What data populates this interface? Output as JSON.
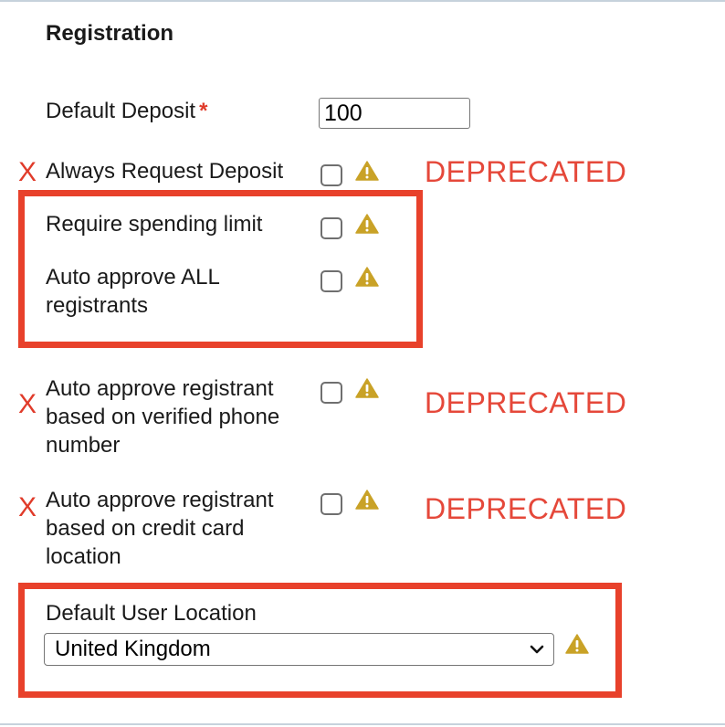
{
  "section": {
    "title": "Registration"
  },
  "fields": {
    "default_deposit": {
      "label": "Default Deposit",
      "required_mark": "*",
      "value": "100"
    },
    "always_request_deposit": {
      "label": "Always Request Deposit",
      "deprecated_mark": "X",
      "deprecated_note": "DEPRECATED",
      "checked": false
    },
    "require_spending_limit": {
      "label": "Require spending limit",
      "checked": false
    },
    "auto_approve_all": {
      "line1": "Auto approve ALL",
      "line2": "registrants",
      "checked": false
    },
    "auto_approve_phone": {
      "line1": "Auto approve registrant",
      "line2": "based on verified phone",
      "line3": "number",
      "deprecated_mark": "X",
      "deprecated_note": "DEPRECATED",
      "checked": false
    },
    "auto_approve_card": {
      "line1": "Auto approve registrant",
      "line2": "based on credit card",
      "line3": "location",
      "deprecated_mark": "X",
      "deprecated_note": "DEPRECATED",
      "checked": false
    },
    "default_user_location": {
      "label": "Default User Location",
      "selected": "United Kingdom"
    }
  },
  "icons": {
    "warning": "warning-triangle-icon",
    "dropdown": "chevron-down-icon"
  },
  "colors": {
    "accent_red": "#e8412b",
    "deprecated_red": "#e5483a",
    "warning_gold": "#c9a227",
    "divider": "#c6d2dc"
  }
}
